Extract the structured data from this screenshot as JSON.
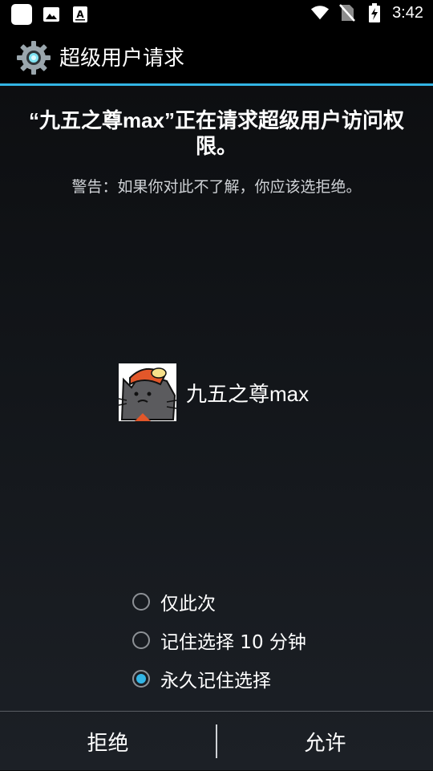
{
  "status_bar": {
    "time": "3:42",
    "icons": [
      "app-square-icon",
      "image-icon",
      "text-a-icon",
      "wifi-icon",
      "no-sim-icon",
      "battery-charging-icon"
    ]
  },
  "action_bar": {
    "icon": "gear-icon",
    "title": "超级用户请求"
  },
  "request": {
    "title": "“九五之尊max”正在请求超级用户访问权限。",
    "warning": "警告：如果你对此不了解，你应该选拒绝。"
  },
  "app": {
    "name": "九五之尊max",
    "avatar": "cat-avatar"
  },
  "options": [
    {
      "label": "仅此次",
      "checked": false
    },
    {
      "label": "记住选择 10 分钟",
      "checked": false
    },
    {
      "label": "永久记住选择",
      "checked": true
    }
  ],
  "buttons": {
    "deny": "拒绝",
    "allow": "允许"
  },
  "colors": {
    "accent": "#33b5e5",
    "background": "#121519"
  }
}
